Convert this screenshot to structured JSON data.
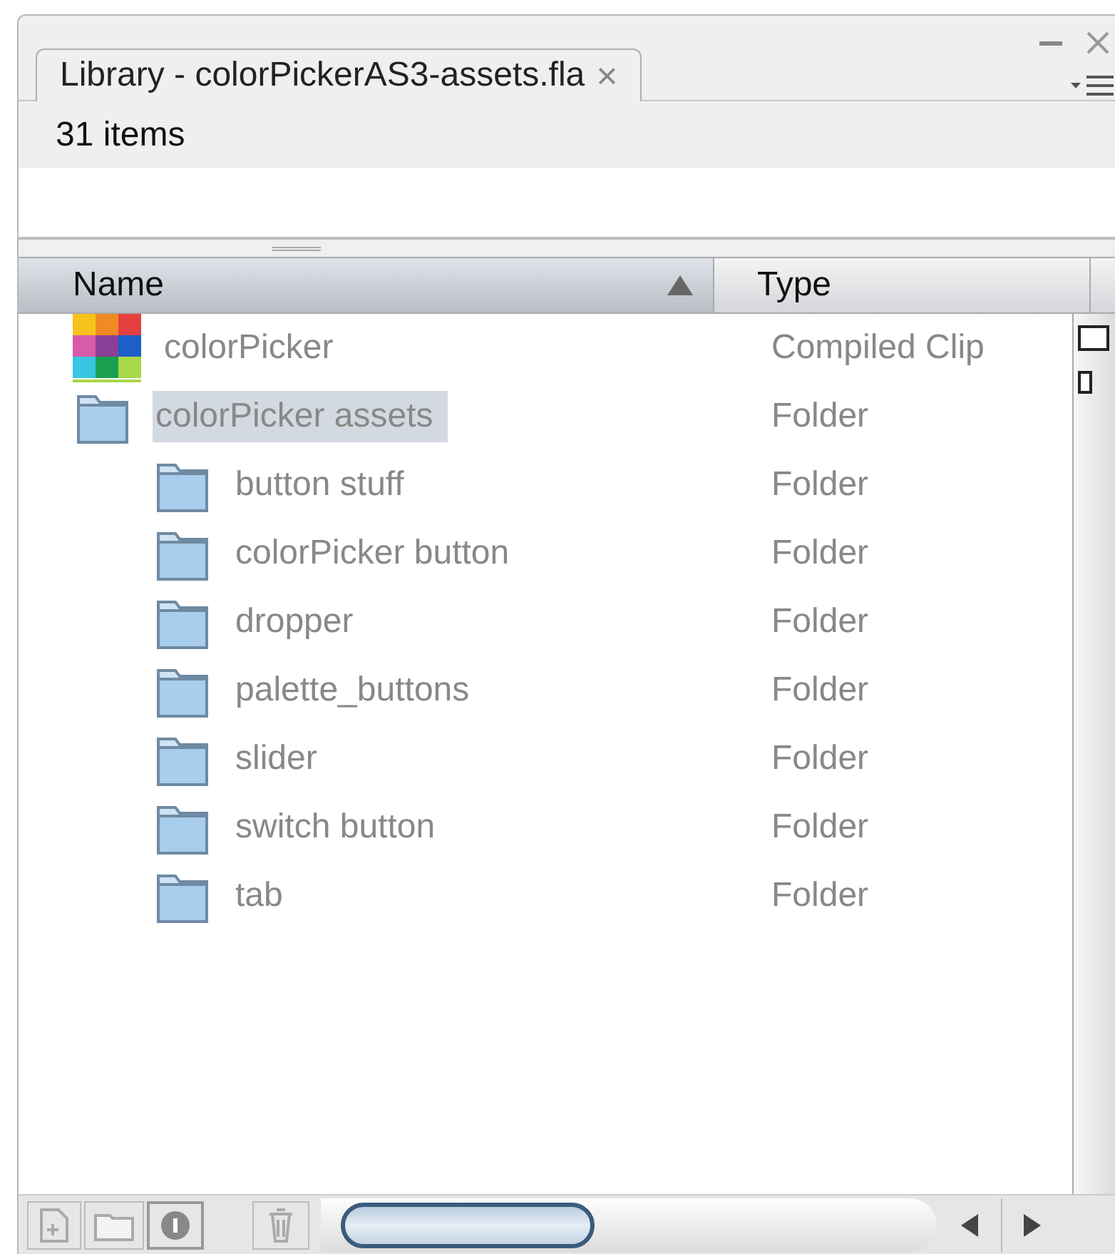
{
  "tab": {
    "label": "Library - colorPickerAS3-assets.fla",
    "close": "×",
    "selected": true
  },
  "item_count": "31 items",
  "columns": [
    "Name",
    "Type"
  ],
  "rows": [
    {
      "name": "colorPicker",
      "type": "Compiled Clip",
      "kind": "clip",
      "selected": false
    },
    {
      "name": "colorPicker assets",
      "type": "Folder",
      "kind": "folder",
      "selected": true,
      "children": [
        {
          "name": "button stuff",
          "type": "Folder",
          "kind": "folder",
          "selected": false
        },
        {
          "name": "colorPicker button",
          "type": "Folder",
          "kind": "folder",
          "selected": false
        },
        {
          "name": "dropper",
          "type": "Folder",
          "kind": "folder",
          "selected": false
        },
        {
          "name": "palette_buttons",
          "type": "Folder",
          "kind": "folder",
          "selected": false
        },
        {
          "name": "slider",
          "type": "Folder",
          "kind": "folder",
          "selected": false
        },
        {
          "name": "switch button",
          "type": "Folder",
          "kind": "folder",
          "selected": false
        },
        {
          "name": "tab",
          "type": "Folder",
          "kind": "folder",
          "selected": false
        }
      ]
    }
  ]
}
